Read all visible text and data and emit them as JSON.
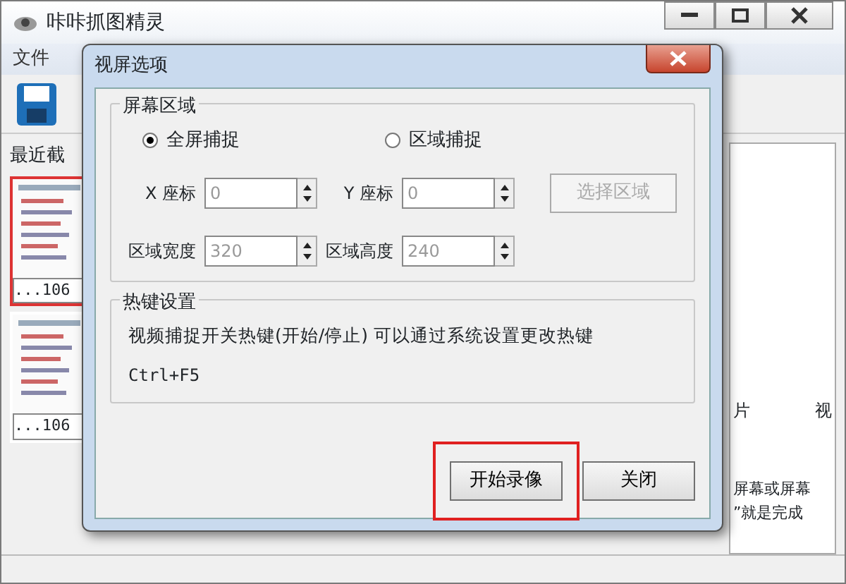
{
  "window": {
    "title": "咔咔抓图精灵",
    "menu": [
      "文件"
    ],
    "sidebar_label": "最近截",
    "thumbnails": [
      {
        "label": "...106",
        "selected": true
      },
      {
        "label": "...106",
        "selected": false
      }
    ],
    "right_panel": {
      "tabs": [
        "片",
        "视"
      ],
      "lines": [
        "屏幕或屏幕",
        "”就是完成"
      ]
    }
  },
  "dialog": {
    "title": "视屏选项",
    "screen_area": {
      "title": "屏幕区域",
      "modes": [
        {
          "label": "全屏捕捉",
          "selected": true
        },
        {
          "label": "区域捕捉",
          "selected": false
        }
      ],
      "fields": [
        {
          "label": "X 座标",
          "value": "0",
          "disabled": true
        },
        {
          "label": "Y 座标",
          "value": "0",
          "disabled": true
        },
        {
          "label": "区域宽度",
          "value": "320",
          "disabled": true
        },
        {
          "label": "区域高度",
          "value": "240",
          "disabled": true
        }
      ],
      "select_button": {
        "label": "选择区域",
        "disabled": true
      }
    },
    "hotkey": {
      "title": "热键设置",
      "description": "视频捕捉开关热键(开始/停止) 可以通过系统设置更改热键",
      "key": "Ctrl+F5"
    },
    "buttons": [
      {
        "label": "开始录像",
        "highlighted": true
      },
      {
        "label": "关闭",
        "highlighted": false
      }
    ]
  }
}
